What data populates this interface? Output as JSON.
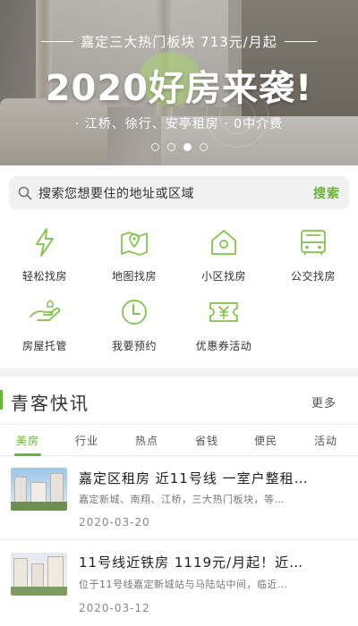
{
  "banner": {
    "subtitle": "嘉定三大热门板块 713元/月起",
    "headline_main": "2020好房来袭",
    "headline_bang": "!",
    "tags": "· 江桥、徐行、安亭租房 · 0中介费",
    "page_count": 4,
    "active_page": 3
  },
  "search": {
    "placeholder": "搜索您想要住的地址或区域",
    "button_label": "搜索"
  },
  "features": [
    {
      "label": "轻松找房",
      "icon": "lightning-icon"
    },
    {
      "label": "地图找房",
      "icon": "map-pin-icon"
    },
    {
      "label": "小区找房",
      "icon": "house-icon"
    },
    {
      "label": "公交找房",
      "icon": "bus-icon"
    },
    {
      "label": "房屋托管",
      "icon": "hand-hold-icon"
    },
    {
      "label": "我要预约",
      "icon": "clock-icon"
    },
    {
      "label": "优惠券活动",
      "icon": "coupon-icon"
    }
  ],
  "news": {
    "title": "青客快讯",
    "more_label": "更多",
    "tabs": [
      "美房",
      "行业",
      "热点",
      "省钱",
      "便民",
      "活动"
    ],
    "active_tab": 0,
    "items": [
      {
        "title": "嘉定区租房 近11号线 一室户整租…",
        "desc": "嘉定新城、南翔、江桥，三大热门板块，等…",
        "date": "2020-03-20"
      },
      {
        "title": "11号线近铁房 1119元/月起！近…",
        "desc": "位于11号线嘉定新城站与马陆站中间，临近…",
        "date": "2020-03-12"
      }
    ]
  },
  "colors": {
    "accent": "#6ab23a"
  }
}
